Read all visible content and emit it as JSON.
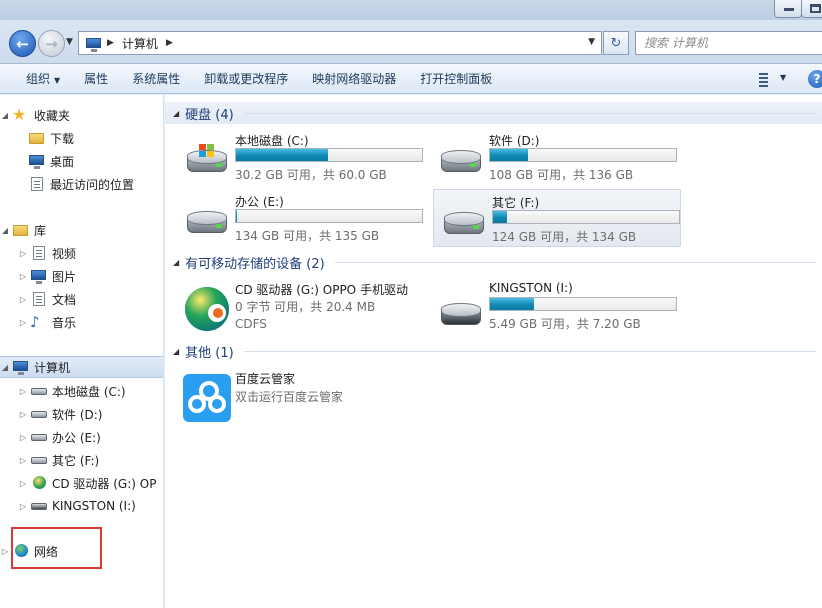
{
  "address": {
    "path": "计算机",
    "search_placeholder": "搜索 计算机"
  },
  "toolbar": {
    "organize": "组织",
    "properties": "属性",
    "system_properties": "系统属性",
    "uninstall": "卸载或更改程序",
    "map_drive": "映射网络驱动器",
    "control_panel": "打开控制面板"
  },
  "nav": {
    "favorites": "收藏夹",
    "downloads": "下载",
    "desktop": "桌面",
    "recent": "最近访问的位置",
    "libraries": "库",
    "videos": "视频",
    "pictures": "图片",
    "documents": "文档",
    "music": "音乐",
    "computer": "计算机",
    "drive_c": "本地磁盘 (C:)",
    "drive_d": "软件 (D:)",
    "drive_e": "办公 (E:)",
    "drive_f": "其它 (F:)",
    "drive_g": "CD 驱动器 (G:) OP",
    "drive_i": "KINGSTON (I:)",
    "network": "网络"
  },
  "groups": {
    "hdd": "硬盘 (4)",
    "removable": "有可移动存储的设备 (2)",
    "other": "其他 (1)"
  },
  "drives": [
    {
      "name": "本地磁盘 (C:)",
      "free": "30.2 GB 可用，共 60.0 GB",
      "used_fraction": 0.497
    },
    {
      "name": "软件 (D:)",
      "free": "108 GB 可用，共 136 GB",
      "used_fraction": 0.206
    },
    {
      "name": "办公 (E:)",
      "free": "134 GB 可用，共 135 GB",
      "used_fraction": 0.007
    },
    {
      "name": "其它 (F:)",
      "free": "124 GB 可用，共 134 GB",
      "used_fraction": 0.075
    }
  ],
  "removable": [
    {
      "name": "CD 驱动器 (G:) OPPO 手机驱动",
      "free": "0 字节 可用，共 20.4 MB",
      "fs": "CDFS"
    },
    {
      "name": "KINGSTON (I:)",
      "free": "5.49 GB 可用，共 7.20 GB",
      "used_fraction": 0.238
    }
  ],
  "other": [
    {
      "name": "百度云管家",
      "desc": "双击运行百度云管家"
    }
  ],
  "colors": {
    "accent": "#1e3f7a",
    "bar_fill": "#1189b4",
    "highlight_box": "#d93a3a"
  }
}
